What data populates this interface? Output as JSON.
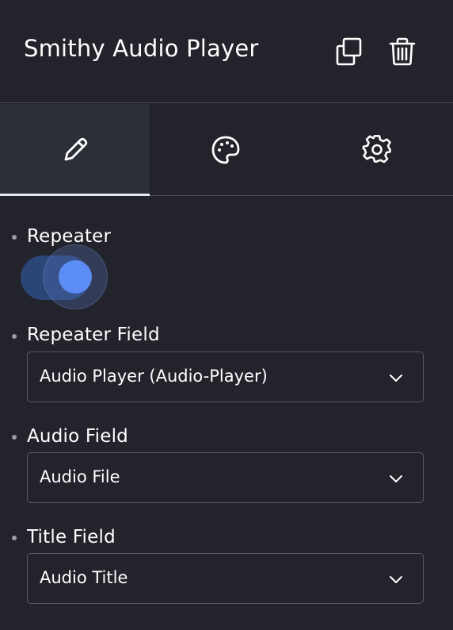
{
  "header": {
    "title": "Smithy Audio Player",
    "icons": [
      "copy-icon",
      "trash-icon"
    ]
  },
  "tabs": [
    {
      "name": "edit",
      "icon": "pencil-icon",
      "active": true
    },
    {
      "name": "style",
      "icon": "palette-icon",
      "active": false
    },
    {
      "name": "settings",
      "icon": "gear-icon",
      "active": false
    }
  ],
  "fields": {
    "repeater": {
      "label": "Repeater",
      "enabled": true
    },
    "repeater_field": {
      "label": "Repeater Field",
      "value": "Audio Player (Audio-Player)"
    },
    "audio_field": {
      "label": "Audio Field",
      "value": "Audio File"
    },
    "title_field": {
      "label": "Title Field",
      "value": "Audio Title"
    }
  },
  "colors": {
    "background": "#22232b",
    "active_tab": "#2d2f38",
    "toggle_on": "#5c8df5"
  }
}
